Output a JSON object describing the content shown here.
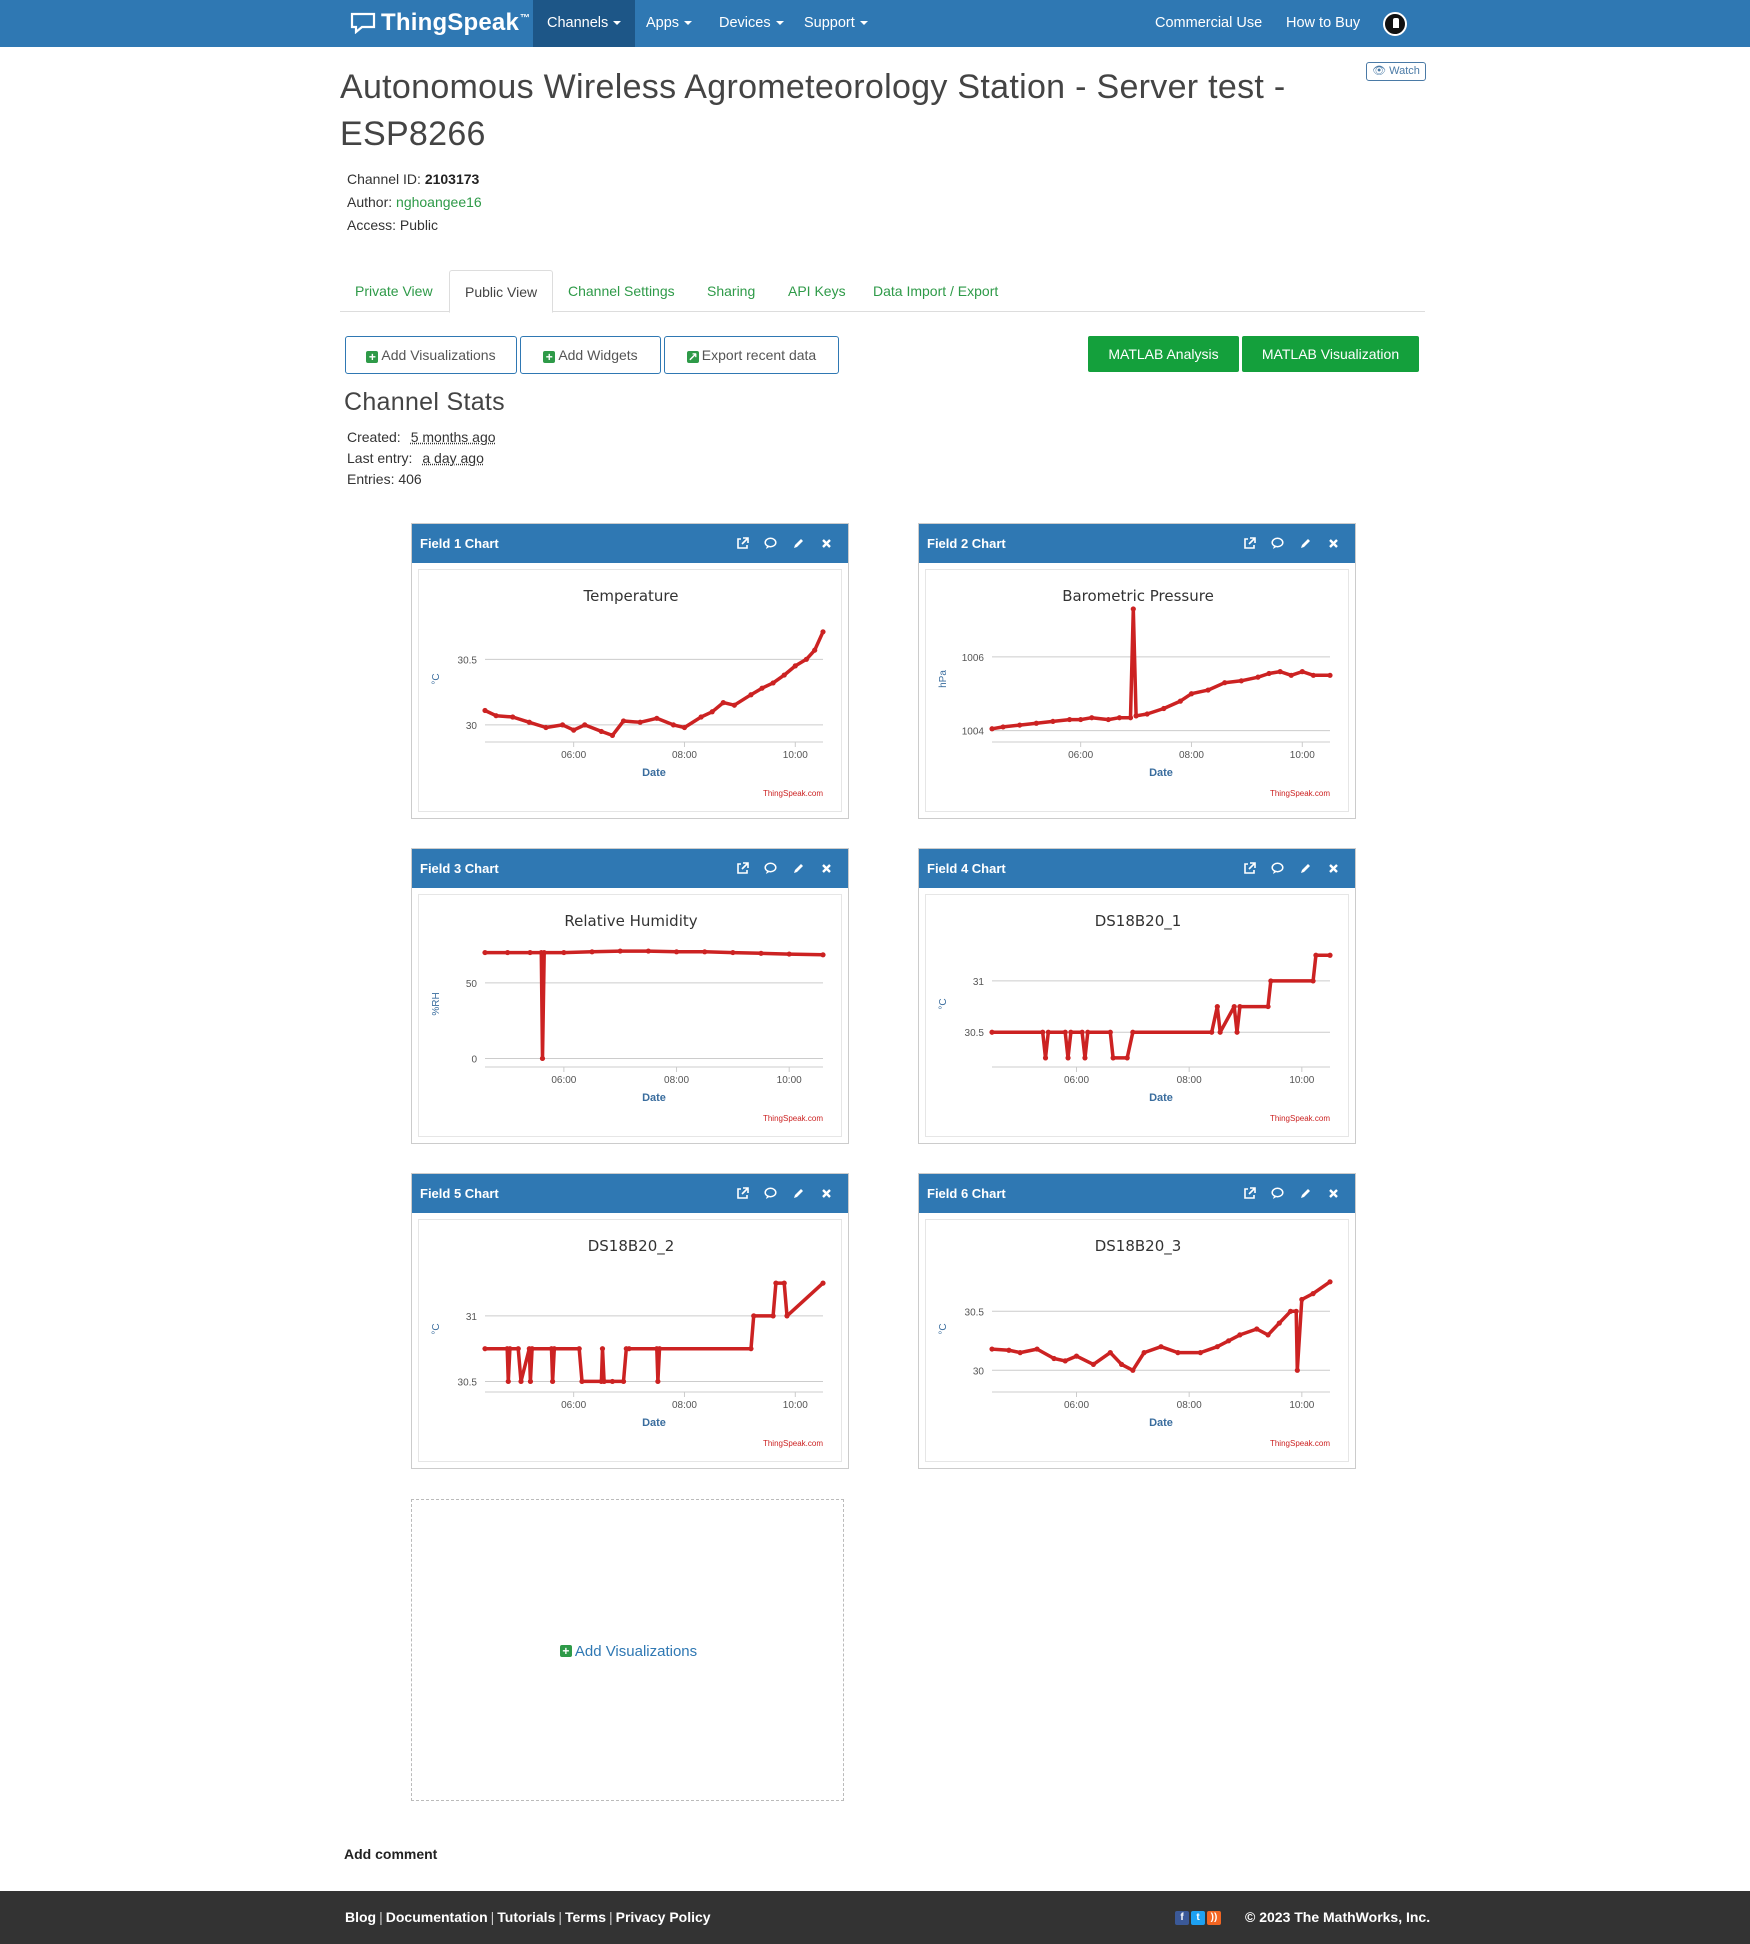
{
  "nav": {
    "brand": "ThingSpeak",
    "brand_tm": "™",
    "items": [
      "Channels",
      "Apps",
      "Devices",
      "Support"
    ],
    "right": [
      "Commercial Use",
      "How to Buy"
    ]
  },
  "header": {
    "title": "Autonomous Wireless Agrometeorology Station - Server test - ESP8266",
    "watch": "Watch",
    "channel_id_label": "Channel ID:",
    "channel_id": "2103173",
    "author_label": "Author:",
    "author": "nghoangee16",
    "access_label": "Access:",
    "access": "Public"
  },
  "tabs": [
    "Private View",
    "Public View",
    "Channel Settings",
    "Sharing",
    "API Keys",
    "Data Import / Export"
  ],
  "buttons": {
    "add_visualizations": "Add Visualizations",
    "add_widgets": "Add Widgets",
    "export_recent": "Export recent data",
    "matlab_analysis": "MATLAB Analysis",
    "matlab_visualization": "MATLAB Visualization"
  },
  "stats": {
    "title": "Channel Stats",
    "created_label": "Created:",
    "created": "5 months ago",
    "last_entry_label": "Last entry:",
    "last_entry": "a day ago",
    "entries_label": "Entries:",
    "entries": "406"
  },
  "chart_data": [
    {
      "panel": "Field 1 Chart",
      "type": "line",
      "title": "Temperature",
      "xlabel": "Date",
      "ylabel": "°C",
      "x_ticks": [
        "06:00",
        "08:00",
        "10:00"
      ],
      "y_ticks": [
        30,
        30.5
      ],
      "ylim": [
        29.9,
        30.8
      ],
      "xlim": [
        4.4,
        10.5
      ],
      "credit": "ThingSpeak.com",
      "color": "#cc2222",
      "series": [
        {
          "x": [
            4.4,
            4.6,
            4.9,
            5.2,
            5.5,
            5.8,
            6.0,
            6.2,
            6.5,
            6.7,
            6.9,
            7.2,
            7.5,
            7.8,
            8.0,
            8.3,
            8.5,
            8.7,
            8.9,
            9.2,
            9.4,
            9.6,
            9.8,
            10.0,
            10.2,
            10.35,
            10.5
          ],
          "y": [
            30.11,
            30.07,
            30.06,
            30.02,
            29.98,
            30.0,
            29.96,
            30.0,
            29.95,
            29.92,
            30.03,
            30.02,
            30.05,
            30.0,
            29.98,
            30.06,
            30.1,
            30.17,
            30.15,
            30.23,
            30.28,
            30.32,
            30.38,
            30.45,
            30.5,
            30.57,
            30.71
          ]
        }
      ]
    },
    {
      "panel": "Field 2 Chart",
      "type": "line",
      "title": "Barometric Pressure",
      "xlabel": "Date",
      "ylabel": "hPa",
      "x_ticks": [
        "06:00",
        "08:00",
        "10:00"
      ],
      "y_ticks": [
        1004,
        1006
      ],
      "ylim": [
        1003.8,
        1007.0
      ],
      "xlim": [
        4.4,
        10.5
      ],
      "credit": "ThingSpeak.com",
      "color": "#cc2222",
      "series": [
        {
          "x": [
            4.4,
            4.6,
            4.9,
            5.2,
            5.5,
            5.8,
            6.0,
            6.2,
            6.5,
            6.7,
            6.9,
            6.95,
            7.0,
            7.2,
            7.5,
            7.8,
            8.0,
            8.3,
            8.6,
            8.9,
            9.2,
            9.4,
            9.6,
            9.8,
            10.0,
            10.2,
            10.5
          ],
          "y": [
            1004.05,
            1004.1,
            1004.15,
            1004.2,
            1004.25,
            1004.3,
            1004.3,
            1004.35,
            1004.3,
            1004.35,
            1004.35,
            1007.3,
            1004.4,
            1004.45,
            1004.6,
            1004.8,
            1005.0,
            1005.1,
            1005.3,
            1005.35,
            1005.45,
            1005.55,
            1005.6,
            1005.5,
            1005.6,
            1005.5,
            1005.5
          ]
        }
      ]
    },
    {
      "panel": "Field 3 Chart",
      "type": "line",
      "title": "Relative Humidity",
      "xlabel": "Date",
      "ylabel": "%RH",
      "x_ticks": [
        "06:00",
        "08:00",
        "10:00"
      ],
      "y_ticks": [
        0,
        50
      ],
      "ylim": [
        -3,
        75
      ],
      "xlim": [
        4.6,
        10.6
      ],
      "credit": "ThingSpeak.com",
      "color": "#cc2222",
      "series": [
        {
          "x": [
            4.6,
            5.0,
            5.4,
            5.6,
            5.62,
            5.65,
            6.0,
            6.5,
            7.0,
            7.5,
            8.0,
            8.5,
            9.0,
            9.5,
            10.0,
            10.6
          ],
          "y": [
            70,
            70,
            70,
            70,
            0,
            70,
            70,
            70.5,
            71,
            71,
            70.5,
            70.5,
            70,
            69.5,
            69,
            68.5
          ]
        }
      ]
    },
    {
      "panel": "Field 4 Chart",
      "type": "line",
      "title": "DS18B20_1",
      "xlabel": "Date",
      "ylabel": "°C",
      "x_ticks": [
        "06:00",
        "08:00",
        "10:00"
      ],
      "y_ticks": [
        30.5,
        31
      ],
      "ylim": [
        30.2,
        31.35
      ],
      "xlim": [
        4.5,
        10.5
      ],
      "credit": "ThingSpeak.com",
      "color": "#cc2222",
      "series": [
        {
          "x": [
            4.5,
            5.4,
            5.45,
            5.5,
            5.8,
            5.85,
            5.9,
            6.1,
            6.15,
            6.2,
            6.6,
            6.65,
            6.9,
            7.0,
            8.4,
            8.5,
            8.55,
            8.8,
            8.85,
            8.9,
            9.4,
            9.45,
            10.2,
            10.25,
            10.5
          ],
          "y": [
            30.5,
            30.5,
            30.25,
            30.5,
            30.5,
            30.25,
            30.5,
            30.5,
            30.25,
            30.5,
            30.5,
            30.25,
            30.25,
            30.5,
            30.5,
            30.75,
            30.5,
            30.75,
            30.5,
            30.75,
            30.75,
            31.0,
            31.0,
            31.25,
            31.25
          ]
        }
      ]
    },
    {
      "panel": "Field 5 Chart",
      "type": "line",
      "title": "DS18B20_2",
      "xlabel": "Date",
      "ylabel": "°C",
      "x_ticks": [
        "06:00",
        "08:00",
        "10:00"
      ],
      "y_ticks": [
        30.5,
        31
      ],
      "ylim": [
        30.45,
        31.35
      ],
      "xlim": [
        4.4,
        10.5
      ],
      "credit": "ThingSpeak.com",
      "color": "#cc2222",
      "series": [
        {
          "x": [
            4.4,
            4.8,
            4.82,
            4.85,
            5.0,
            5.05,
            5.2,
            5.22,
            5.25,
            5.6,
            5.62,
            5.65,
            6.1,
            6.15,
            6.5,
            6.52,
            6.55,
            6.7,
            6.9,
            6.95,
            7.0,
            7.5,
            7.52,
            7.55,
            9.2,
            9.25,
            9.6,
            9.65,
            9.8,
            9.85,
            10.5
          ],
          "y": [
            30.75,
            30.75,
            30.5,
            30.75,
            30.75,
            30.5,
            30.75,
            30.5,
            30.75,
            30.75,
            30.5,
            30.75,
            30.75,
            30.5,
            30.5,
            30.75,
            30.5,
            30.5,
            30.5,
            30.75,
            30.75,
            30.75,
            30.5,
            30.75,
            30.75,
            31.0,
            31.0,
            31.25,
            31.25,
            31.0,
            31.25
          ]
        }
      ]
    },
    {
      "panel": "Field 6 Chart",
      "type": "line",
      "title": "DS18B20_3",
      "xlabel": "Date",
      "ylabel": "°C",
      "x_ticks": [
        "06:00",
        "08:00",
        "10:00"
      ],
      "y_ticks": [
        30,
        30.5
      ],
      "ylim": [
        29.85,
        30.85
      ],
      "xlim": [
        4.5,
        10.5
      ],
      "credit": "ThingSpeak.com",
      "color": "#cc2222",
      "series": [
        {
          "x": [
            4.5,
            4.8,
            5.0,
            5.3,
            5.6,
            5.8,
            6.0,
            6.3,
            6.6,
            6.8,
            7.0,
            7.2,
            7.5,
            7.8,
            8.2,
            8.5,
            8.7,
            8.9,
            9.2,
            9.4,
            9.6,
            9.8,
            9.9,
            9.92,
            10.0,
            10.2,
            10.5
          ],
          "y": [
            30.18,
            30.17,
            30.15,
            30.18,
            30.1,
            30.08,
            30.12,
            30.05,
            30.15,
            30.05,
            30.0,
            30.15,
            30.2,
            30.15,
            30.15,
            30.2,
            30.25,
            30.3,
            30.35,
            30.3,
            30.4,
            30.5,
            30.5,
            30.0,
            30.6,
            30.65,
            30.75
          ]
        }
      ]
    }
  ],
  "add_vis_box": "Add Visualizations",
  "add_comment": "Add comment",
  "footer": {
    "links": [
      "Blog",
      "Documentation",
      "Tutorials",
      "Terms",
      "Privacy Policy"
    ],
    "copyright": "© 2023 The MathWorks, Inc."
  }
}
